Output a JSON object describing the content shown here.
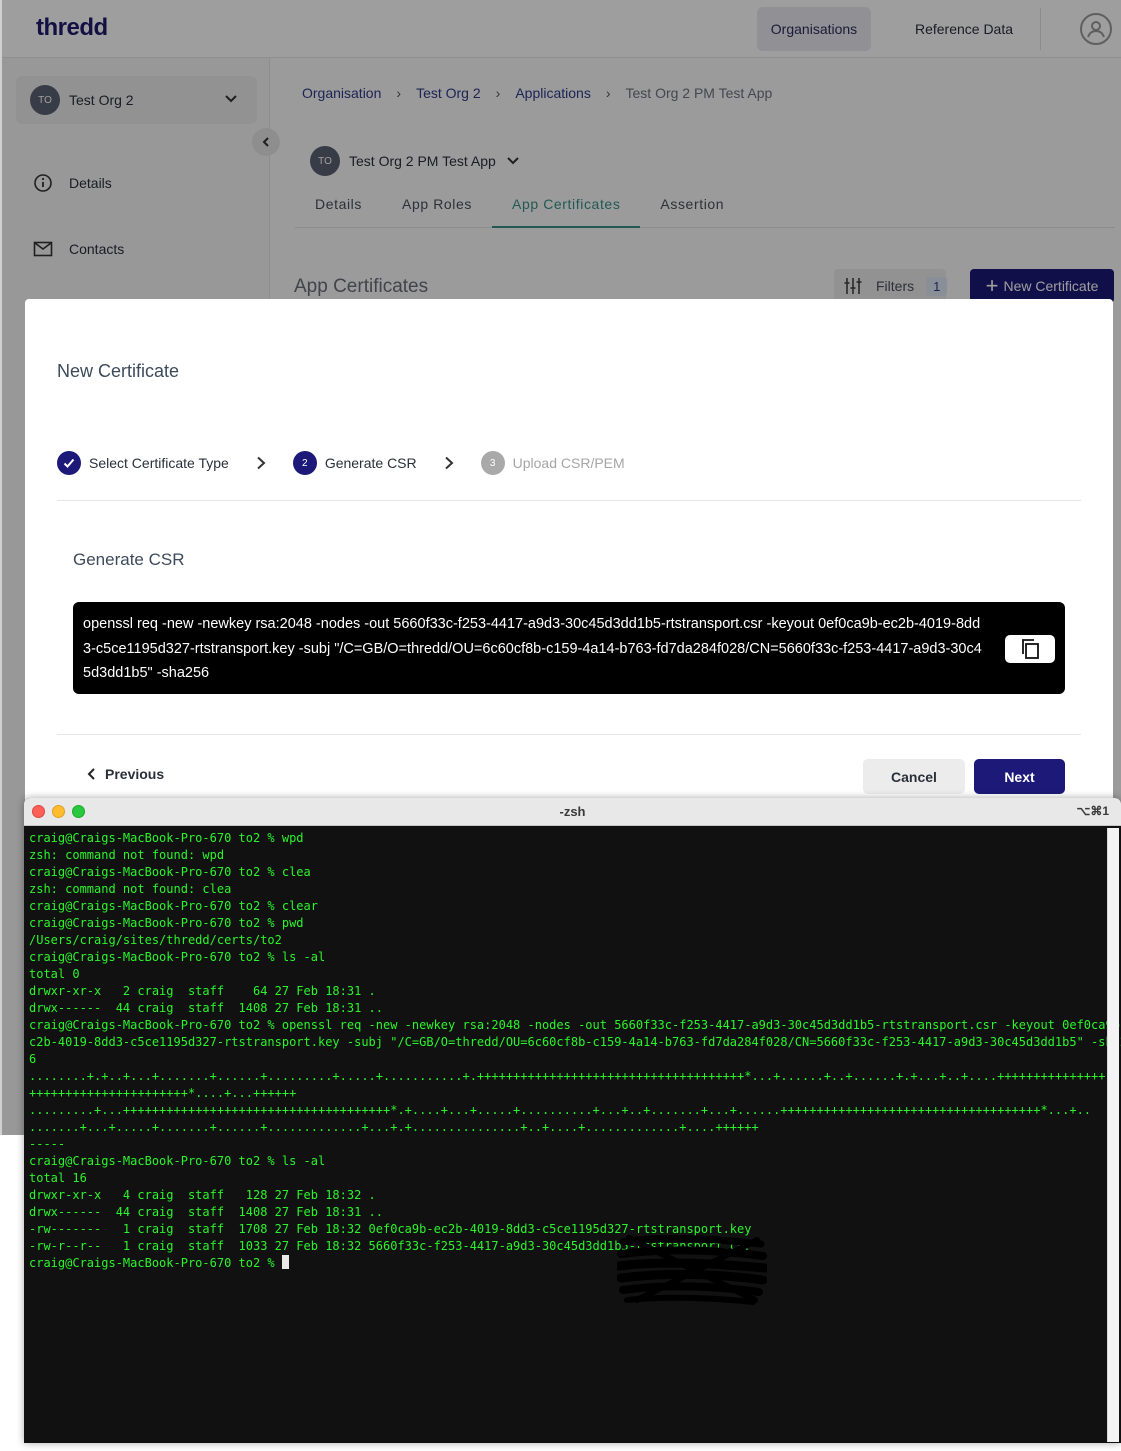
{
  "app": {
    "logo": "thredd",
    "nav": {
      "organisations": "Organisations",
      "reference_data": "Reference Data"
    },
    "sidebar": {
      "org_initials": "TO",
      "org_name": "Test Org 2",
      "items": [
        {
          "label": "Details",
          "icon": "info-icon"
        },
        {
          "label": "Contacts",
          "icon": "mail-icon"
        }
      ]
    },
    "breadcrumb": [
      "Organisation",
      "Test Org 2",
      "Applications",
      "Test Org 2 PM Test App"
    ],
    "app_selector": {
      "initials": "TO",
      "name": "Test Org 2 PM Test App"
    },
    "tabs": [
      {
        "label": "Details",
        "active": false
      },
      {
        "label": "App Roles",
        "active": false
      },
      {
        "label": "App Certificates",
        "active": true
      },
      {
        "label": "Assertion",
        "active": false
      }
    ],
    "section_title": "App Certificates",
    "filters": {
      "label": "Filters",
      "count": "1"
    },
    "new_certificate": "New Certificate"
  },
  "modal": {
    "title": "New Certificate",
    "steps": [
      {
        "number": "1",
        "label": "Select Certificate Type",
        "state": "done"
      },
      {
        "number": "2",
        "label": "Generate CSR",
        "state": "active"
      },
      {
        "number": "3",
        "label": "Upload CSR/PEM",
        "state": "pending"
      }
    ],
    "section_title": "Generate CSR",
    "command": "openssl req -new -newkey rsa:2048 -nodes -out 5660f33c-f253-4417-a9d3-30c45d3dd1b5-rtstransport.csr -keyout 0ef0ca9b-ec2b-4019-8dd3-c5ce1195d327-rtstransport.key -subj \"/C=GB/O=thredd/OU=6c60cf8b-c159-4a14-b763-fd7da284f028/CN=5660f33c-f253-4417-a9d3-30c45d3dd1b5\" -sha256",
    "previous": "Previous",
    "cancel": "Cancel",
    "next": "Next"
  },
  "terminal": {
    "title": "-zsh",
    "shortcut": "⌥⌘1",
    "lines": [
      "craig@Craigs-MacBook-Pro-670 to2 % wpd",
      "zsh: command not found: wpd",
      "craig@Craigs-MacBook-Pro-670 to2 % clea",
      "zsh: command not found: clea",
      "craig@Craigs-MacBook-Pro-670 to2 % clear",
      "craig@Craigs-MacBook-Pro-670 to2 % pwd",
      "/Users/craig/sites/thredd/certs/to2",
      "craig@Craigs-MacBook-Pro-670 to2 % ls -al",
      "total 0",
      "drwxr-xr-x   2 craig  staff    64 27 Feb 18:31 .",
      "drwx------  44 craig  staff  1408 27 Feb 18:31 ..",
      "craig@Craigs-MacBook-Pro-670 to2 % openssl req -new -newkey rsa:2048 -nodes -out 5660f33c-f253-4417-a9d3-30c45d3dd1b5-rtstransport.csr -keyout 0ef0ca9b-e",
      "c2b-4019-8dd3-c5ce1195d327-rtstransport.key -subj \"/C=GB/O=thredd/OU=6c60cf8b-c159-4a14-b763-fd7da284f028/CN=5660f33c-f253-4417-a9d3-30c45d3dd1b5\" -sha25",
      "6",
      "........+.+..+...+.......+......+.........+.....+...........+.+++++++++++++++++++++++++++++++++++++*...+......+..+......+.+...+..+....+++++++++++++++",
      "++++++++++++++++++++++*....+...++++++",
      ".........+...+++++++++++++++++++++++++++++++++++++*.+....+...+.....+..........+...+..+.......+...+......++++++++++++++++++++++++++++++++++++*...+..",
      ".......+...+.....+.......+......+.............+...+.+...............+..+....+.............+....++++++",
      "-----",
      "craig@Craigs-MacBook-Pro-670 to2 % ls -al",
      "total 16",
      "drwxr-xr-x   4 craig  staff   128 27 Feb 18:32 .",
      "drwx------  44 craig  staff  1408 27 Feb 18:31 ..",
      "-rw-------   1 craig  staff  1708 27 Feb 18:32 0ef0ca9b-ec2b-4019-8dd3-c5ce1195d327-rtstransport.key",
      "-rw-r--r--   1 craig  staff  1033 27 Feb 18:32 5660f33c-f253-4417-a9d3-30c45d3dd1b5-rtstransport.csr",
      "craig@Craigs-MacBook-Pro-670 to2 % "
    ]
  },
  "colors": {
    "brand_navy": "#1c1978",
    "tab_active": "#3a8f86",
    "terminal_text": "#2cf42c"
  }
}
